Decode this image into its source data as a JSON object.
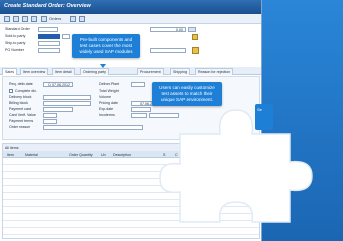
{
  "window": {
    "title": "Create Standard Order: Overview"
  },
  "toolbar": {
    "orders_label": "Orders"
  },
  "header": {
    "fields": [
      {
        "label": "Standard Order",
        "value": "0.00"
      },
      {
        "label": "Sold-to party",
        "value": ""
      },
      {
        "label": "Ship-to party",
        "value": ""
      },
      {
        "label": "PO Number",
        "value": ""
      }
    ]
  },
  "tabs": [
    "Sales",
    "Item overview",
    "Item detail",
    "Ordering party",
    "Procurement",
    "Shipping",
    "Reason for rejection"
  ],
  "sales": {
    "left": [
      {
        "label": "Req. deliv.date",
        "value": "D  07.06.2012"
      },
      {
        "label": "Complete div.",
        "value": ""
      },
      {
        "label": "Delivery block",
        "value": ""
      },
      {
        "label": "Billing block",
        "value": ""
      },
      {
        "label": "Payment card",
        "value": ""
      },
      {
        "label": "Card Verif. Value",
        "value": ""
      },
      {
        "label": "Payment terms",
        "value": ""
      },
      {
        "label": "Order reason",
        "value": ""
      }
    ],
    "right": [
      {
        "label": "Deliver.Plant",
        "value": ""
      },
      {
        "label": "Total Weight",
        "value": ""
      },
      {
        "label": "Volume",
        "value": ""
      },
      {
        "label": "Pricing date",
        "value": "07.06.2012"
      },
      {
        "label": "Exp.date",
        "value": ""
      },
      {
        "label": "Incoterms",
        "value": ""
      }
    ]
  },
  "items_grid": {
    "title": "All items",
    "columns": [
      "Item",
      "Material",
      "Order Quantity",
      "Un",
      "Description",
      "S",
      "C",
      "Numbe"
    ]
  },
  "callouts": {
    "top": "Pre-built components and test cases cover the most widely used SAP modules",
    "middle": "Users can easily customize test assets to match their unique SAP environment.",
    "edge": "Se"
  },
  "icons": [
    "puzzle-piece-icon",
    "orders-icon",
    "search-icon",
    "calendar-icon"
  ],
  "colors": {
    "accent": "#1e7fd6",
    "background": "#1d6fbf",
    "title_bar": "#1a4f90"
  }
}
